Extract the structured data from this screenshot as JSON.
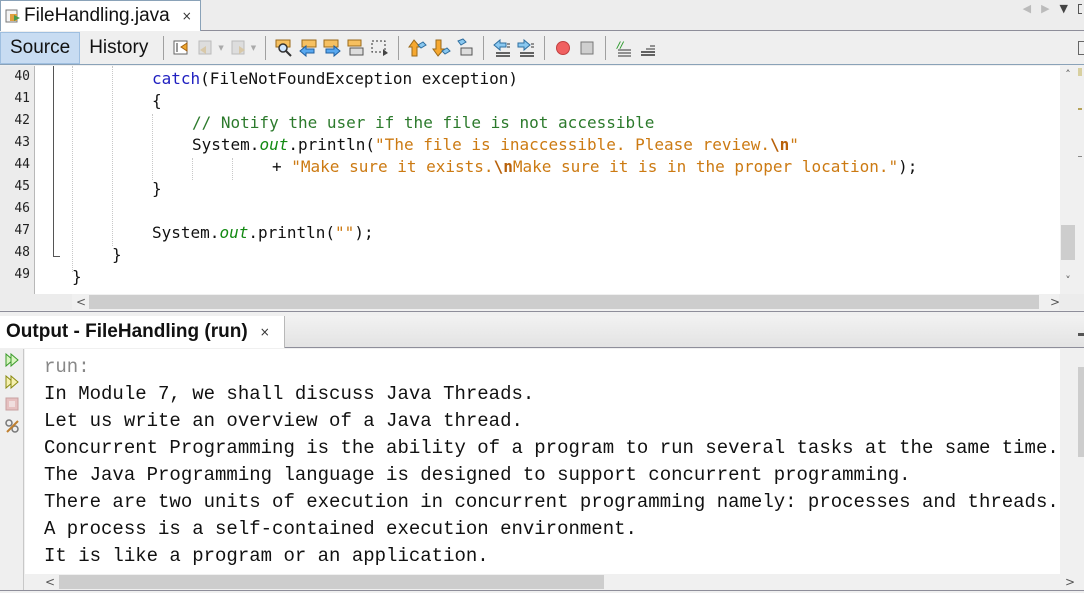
{
  "editor_tab": {
    "title": "FileHandling.java",
    "close": "×",
    "icon": "java-file-icon"
  },
  "toolbar": {
    "source_label": "Source",
    "history_label": "History",
    "icons": [
      "last-edit-icon",
      "back-icon",
      "forward-icon",
      "find-selection-icon",
      "find-previous-icon",
      "find-next-icon",
      "toggle-highlight-icon",
      "rectangular-selection-icon",
      "previous-bookmark-icon",
      "next-bookmark-icon",
      "toggle-bookmark-icon",
      "shift-left-icon",
      "shift-right-icon",
      "start-macro-icon",
      "stop-macro-icon",
      "comment-icon",
      "uncomment-icon"
    ]
  },
  "editor": {
    "line_numbers": [
      "40",
      "41",
      "42",
      "43",
      "44",
      "45",
      "46",
      "47",
      "48",
      "49"
    ],
    "lines": {
      "l40_kw": "catch",
      "l40_rest": "(FileNotFoundException exception)",
      "l41": "{",
      "l42_comment": "// Notify the user if the file is not accessible",
      "l43_a": "System.",
      "l43_field": "out",
      "l43_b": ".println(",
      "l43_str": "\"The file is inaccessible. Please review.",
      "l43_esc": "\\n",
      "l43_str_end": "\"",
      "l44_plus": "+ ",
      "l44_str1": "\"Make sure it exists.",
      "l44_esc": "\\n",
      "l44_str2": "Make sure it is in the proper location.\"",
      "l44_end": ");",
      "l45": "}",
      "l47_a": "System.",
      "l47_field": "out",
      "l47_b": ".println(",
      "l47_str": "\"\"",
      "l47_end": ");",
      "l48": "}",
      "l49": "}"
    },
    "scroll_up": "˄",
    "scroll_down": "˅",
    "scroll_left": "<",
    "scroll_right": ">"
  },
  "output": {
    "tab_title": "Output - FileHandling (run)",
    "close": "×",
    "side_icons": [
      "rerun-icon",
      "rerun-with-options-icon",
      "stop-icon",
      "settings-icon"
    ],
    "lines": [
      "run:",
      "In Module 7, we shall discuss Java Threads.",
      "Let us write an overview of a Java thread.",
      "Concurrent Programming is the ability of a program to run several tasks at the same time.",
      "The Java Programming language is designed to support concurrent programming.",
      "There are two units of execution in concurrent programming namely: processes and threads.",
      "A process is a self-contained execution environment.",
      "It is like a program or an application."
    ],
    "scroll_left": "<",
    "scroll_right": ">"
  },
  "colors": {
    "keyword": "#2020c0",
    "comment": "#2c7a2c",
    "string": "#cc7a12",
    "field": "#138a13",
    "active_view": "#c8dcf2"
  }
}
